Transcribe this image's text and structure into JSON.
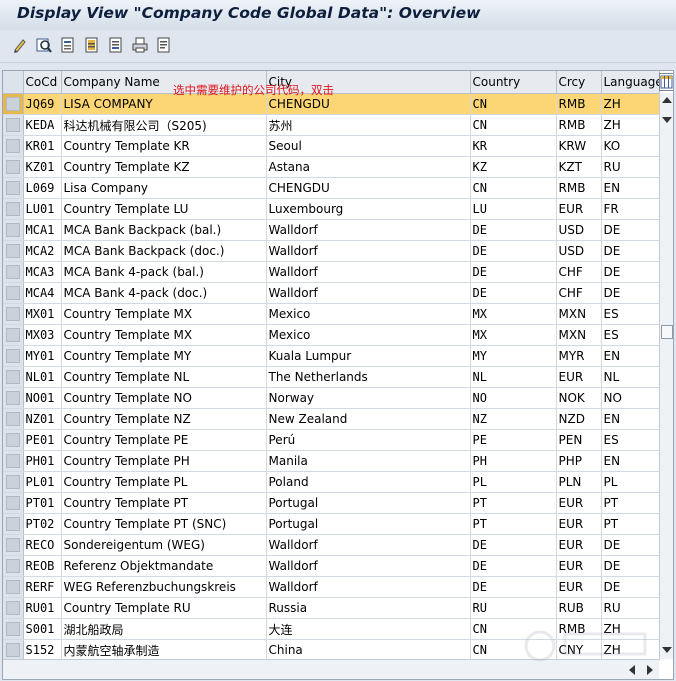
{
  "window": {
    "title": "Display View \"Company Code Global Data\": Overview"
  },
  "toolbar": {
    "buttons": [
      {
        "icon": "display-change-icon"
      },
      {
        "icon": "find-icon"
      },
      {
        "icon": "details-icon"
      },
      {
        "icon": "select-all-icon"
      },
      {
        "icon": "select-block-icon"
      },
      {
        "icon": "print-icon"
      },
      {
        "icon": "list-icon"
      }
    ]
  },
  "annotation": "选中需要维护的公司代码，双击",
  "table": {
    "columns": [
      "CoCd",
      "Company Name",
      "City",
      "Country",
      "Crcy",
      "Language"
    ],
    "selected_row": 0,
    "rows": [
      [
        "JQ69",
        "LISA COMPANY",
        "CHENGDU",
        "CN",
        "RMB",
        "ZH"
      ],
      [
        "KEDA",
        "科达机械有限公司（S205)",
        "苏州",
        "CN",
        "RMB",
        "ZH"
      ],
      [
        "KR01",
        "Country Template KR",
        "Seoul",
        "KR",
        "KRW",
        "KO"
      ],
      [
        "KZ01",
        "Country Template KZ",
        "Astana",
        "KZ",
        "KZT",
        "RU"
      ],
      [
        "L069",
        "Lisa Company",
        "CHENGDU",
        "CN",
        "RMB",
        "EN"
      ],
      [
        "LU01",
        "Country Template LU",
        "Luxembourg",
        "LU",
        "EUR",
        "FR"
      ],
      [
        "MCA1",
        "MCA Bank Backpack (bal.)",
        "Walldorf",
        "DE",
        "USD",
        "DE"
      ],
      [
        "MCA2",
        "MCA Bank Backpack (doc.)",
        "Walldorf",
        "DE",
        "USD",
        "DE"
      ],
      [
        "MCA3",
        "MCA Bank 4-pack (bal.)",
        "Walldorf",
        "DE",
        "CHF",
        "DE"
      ],
      [
        "MCA4",
        "MCA Bank 4-pack (doc.)",
        "Walldorf",
        "DE",
        "CHF",
        "DE"
      ],
      [
        "MX01",
        "Country Template MX",
        "Mexico",
        "MX",
        "MXN",
        "ES"
      ],
      [
        "MX03",
        "Country Template MX",
        "Mexico",
        "MX",
        "MXN",
        "ES"
      ],
      [
        "MY01",
        "Country Template MY",
        "Kuala Lumpur",
        "MY",
        "MYR",
        "EN"
      ],
      [
        "NL01",
        "Country Template NL",
        "The Netherlands",
        "NL",
        "EUR",
        "NL"
      ],
      [
        "NO01",
        "Country Template NO",
        "Norway",
        "NO",
        "NOK",
        "NO"
      ],
      [
        "NZ01",
        "Country Template NZ",
        "New Zealand",
        "NZ",
        "NZD",
        "EN"
      ],
      [
        "PE01",
        "Country Template PE",
        "Perú",
        "PE",
        "PEN",
        "ES"
      ],
      [
        "PH01",
        "Country Template PH",
        "Manila",
        "PH",
        "PHP",
        "EN"
      ],
      [
        "PL01",
        "Country Template PL",
        "Poland",
        "PL",
        "PLN",
        "PL"
      ],
      [
        "PT01",
        "Country Template PT",
        "Portugal",
        "PT",
        "EUR",
        "PT"
      ],
      [
        "PT02",
        "Country Template PT (SNC)",
        "Portugal",
        "PT",
        "EUR",
        "PT"
      ],
      [
        "RECO",
        "Sondereigentum (WEG)",
        "Walldorf",
        "DE",
        "EUR",
        "DE"
      ],
      [
        "REOB",
        "Referenz Objektmandate",
        "Walldorf",
        "DE",
        "EUR",
        "DE"
      ],
      [
        "RERF",
        "WEG Referenzbuchungskreis",
        "Walldorf",
        "DE",
        "EUR",
        "DE"
      ],
      [
        "RU01",
        "Country Template RU",
        "Russia",
        "RU",
        "RUB",
        "RU"
      ],
      [
        "S001",
        "湖北船政局",
        "大连",
        "CN",
        "RMB",
        "ZH"
      ],
      [
        "S152",
        "内蒙航空轴承制造",
        "China",
        "CN",
        "CNY",
        "ZH"
      ]
    ]
  }
}
